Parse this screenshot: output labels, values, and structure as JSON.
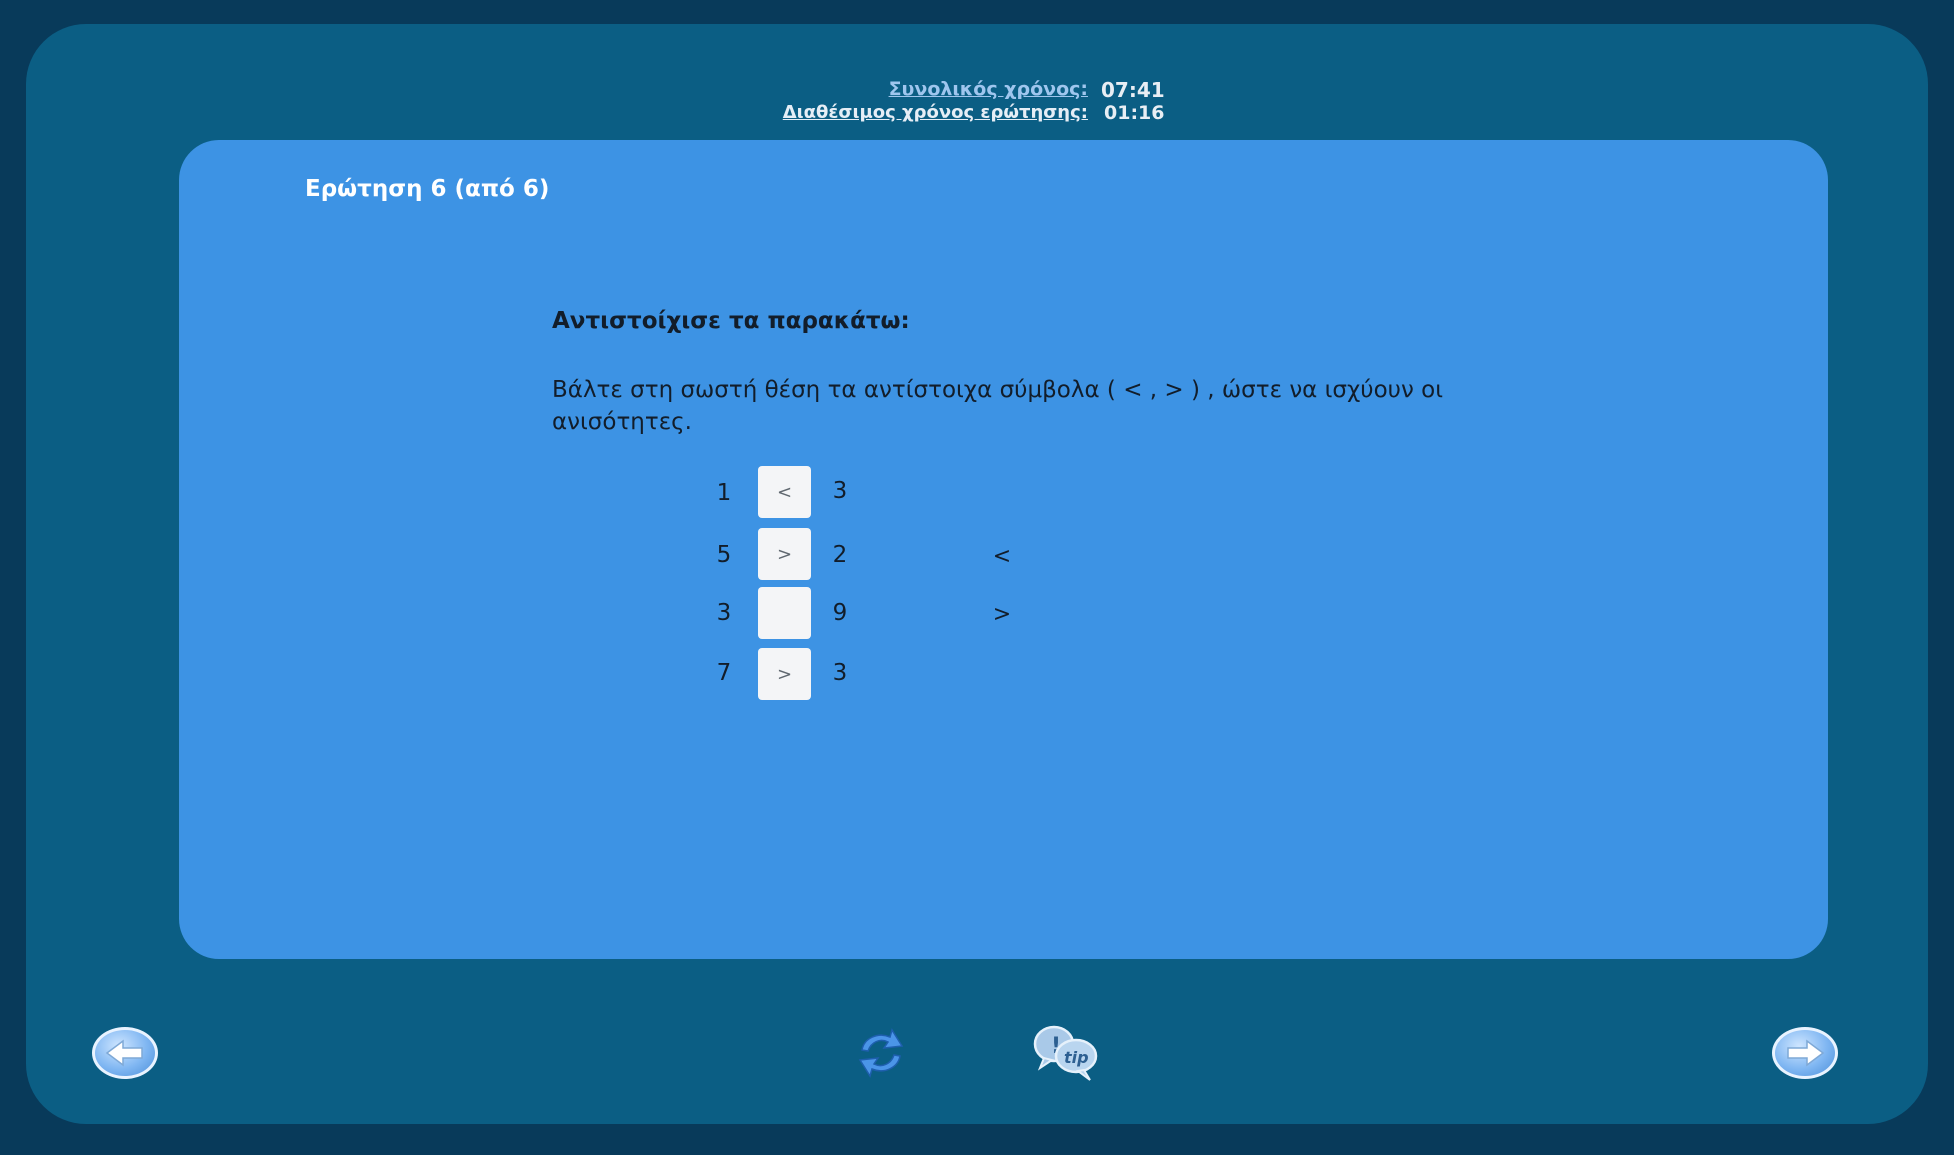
{
  "timers": {
    "total_label": "Συνολικός χρόνος:",
    "total_value": "07:41",
    "question_label": "Διαθέσιμος χρόνος ερώτησης:",
    "question_value": "01:16"
  },
  "question": {
    "number_label": "Ερώτηση 6 (από 6)",
    "title": "Αντιστοίχισε τα παρακάτω:",
    "text": "Βάλτε στη σωστή θέση τα αντίστοιχα σύμβολα ( <  , > ) , ώστε να ισχύουν οι ανισότητες."
  },
  "rows": [
    {
      "left": "1",
      "slot": "<",
      "right": "3"
    },
    {
      "left": "5",
      "slot": ">",
      "right": "2"
    },
    {
      "left": "3",
      "slot": "",
      "right": "9"
    },
    {
      "left": "7",
      "slot": ">",
      "right": "3"
    }
  ],
  "choices": [
    "<",
    ">"
  ],
  "icons": {
    "back": "arrow-left-icon",
    "reload": "refresh-icon",
    "tip": "tip-icon",
    "next": "arrow-right-icon"
  },
  "colors": {
    "background": "#083a5a",
    "frame": "#0b5e84",
    "panel": "#3d93e4",
    "slot": "#f4f5f7"
  }
}
